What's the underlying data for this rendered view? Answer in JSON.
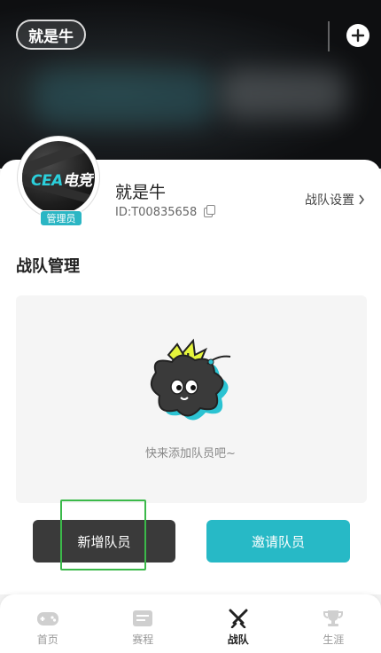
{
  "header": {
    "team_pill": "就是牛",
    "add_icon": "plus-circle-icon"
  },
  "team": {
    "name": "就是牛",
    "id": "ID:T00835658",
    "role_tag": "管理员",
    "settings_link": "战队设置",
    "logo_prefix": "CEA",
    "logo_suffix": "电竞"
  },
  "section": {
    "title": "战队管理",
    "empty_text": "快来添加队员吧~"
  },
  "actions": {
    "add_member": "新增队员",
    "invite_member": "邀请队员"
  },
  "nav": {
    "items": [
      {
        "label": "首页",
        "icon": "gamepad-icon",
        "active": false
      },
      {
        "label": "赛程",
        "icon": "schedule-icon",
        "active": false
      },
      {
        "label": "战队",
        "icon": "crossed-swords-icon",
        "active": true
      },
      {
        "label": "生涯",
        "icon": "trophy-icon",
        "active": false
      }
    ]
  },
  "colors": {
    "accent": "#27b9c6",
    "dark_button": "#3a3a3a",
    "highlight": "#3bb94a"
  }
}
